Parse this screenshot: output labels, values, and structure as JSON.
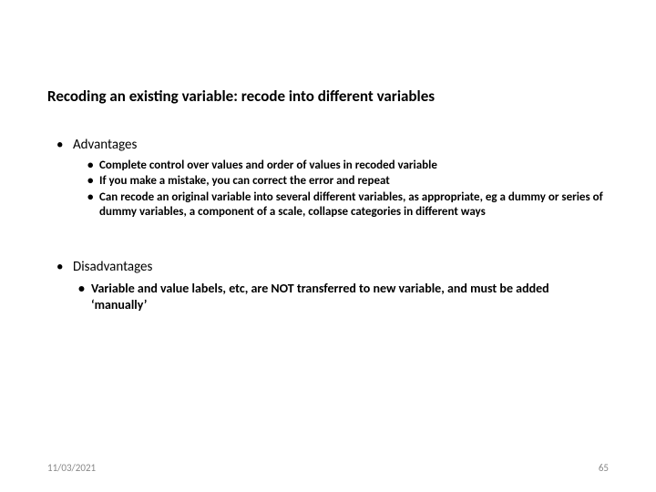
{
  "title": "Recoding an existing variable: recode into different variables",
  "advantages": {
    "heading": "Advantages",
    "items": [
      "Complete control over values and order of values in recoded variable",
      "If you make a mistake, you can correct the error and repeat",
      "Can recode an original variable into several different variables, as appropriate, eg a dummy or series of dummy variables, a component of a scale, collapse categories in different ways"
    ]
  },
  "disadvantages": {
    "heading": "Disadvantages",
    "items": [
      "Variable and value labels, etc, are NOT transferred to new variable, and must be added ‘manually’"
    ]
  },
  "footer": {
    "date": "11/03/2021",
    "page": "65"
  }
}
